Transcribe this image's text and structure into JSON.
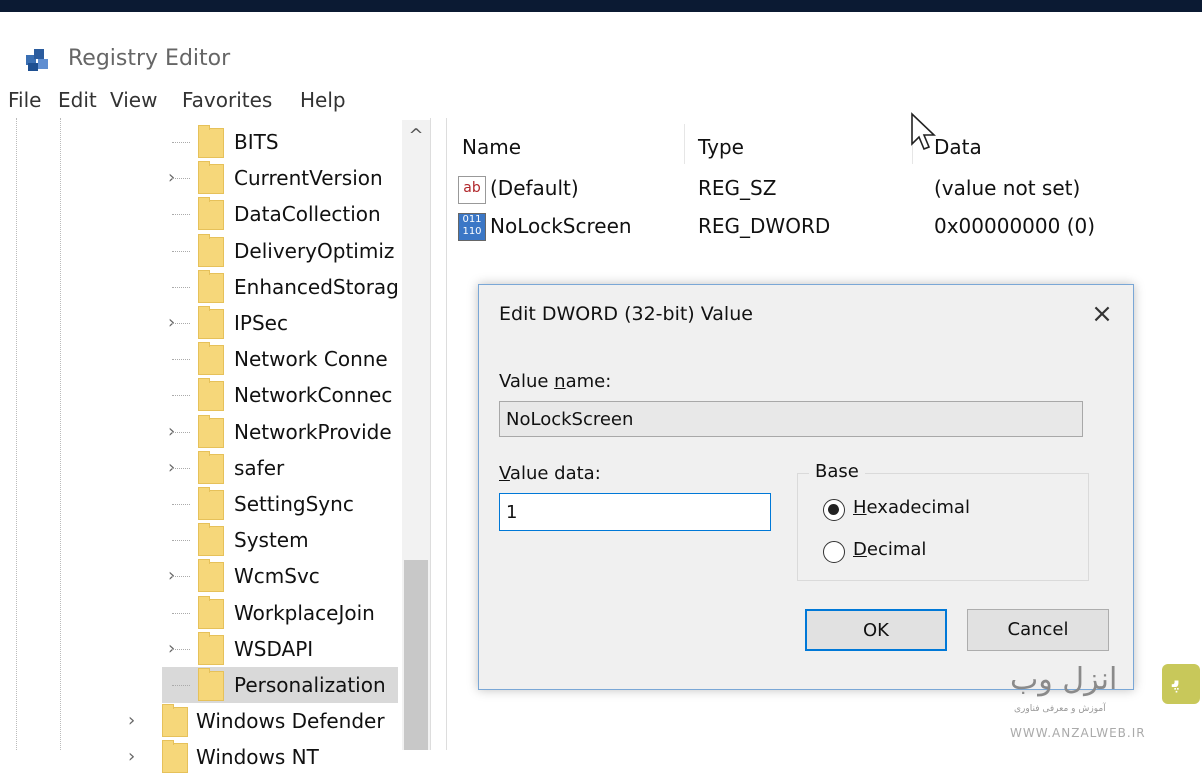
{
  "window": {
    "title": "Registry Editor"
  },
  "menu": [
    "File",
    "Edit",
    "View",
    "Favorites",
    "Help"
  ],
  "tree": {
    "items": [
      {
        "label": "BITS",
        "expandable": false
      },
      {
        "label": "CurrentVersion",
        "expandable": true
      },
      {
        "label": "DataCollection",
        "expandable": false
      },
      {
        "label": "DeliveryOptimiz",
        "expandable": false
      },
      {
        "label": "EnhancedStorag",
        "expandable": false
      },
      {
        "label": "IPSec",
        "expandable": true
      },
      {
        "label": "Network Conne",
        "expandable": false
      },
      {
        "label": "NetworkConnec",
        "expandable": false
      },
      {
        "label": "NetworkProvide",
        "expandable": true
      },
      {
        "label": "safer",
        "expandable": true
      },
      {
        "label": "SettingSync",
        "expandable": false
      },
      {
        "label": "System",
        "expandable": false
      },
      {
        "label": "WcmSvc",
        "expandable": true
      },
      {
        "label": "WorkplaceJoin",
        "expandable": false
      },
      {
        "label": "WSDAPI",
        "expandable": true
      },
      {
        "label": "Personalization",
        "expandable": false,
        "selected": true
      }
    ],
    "parent_items": [
      {
        "label": "Windows Defender",
        "expandable": true
      },
      {
        "label": "Windows NT",
        "expandable": true
      }
    ]
  },
  "values_pane": {
    "headers": {
      "name": "Name",
      "type": "Type",
      "data": "Data"
    },
    "rows": [
      {
        "icon": "string-value-icon",
        "icon_text": "ab",
        "name": "(Default)",
        "type": "REG_SZ",
        "data": "(value not set)"
      },
      {
        "icon": "dword-value-icon",
        "icon_text": "011 110",
        "name": "NoLockScreen",
        "type": "REG_DWORD",
        "data": "0x00000000 (0)"
      }
    ]
  },
  "dialog": {
    "title": "Edit DWORD (32-bit) Value",
    "close": "×",
    "value_name_label": {
      "pre": "Value ",
      "accel": "n",
      "post": "ame:"
    },
    "value_name": "NoLockScreen",
    "value_data_label": {
      "pre": "",
      "accel": "V",
      "post": "alue data:"
    },
    "value_data": "1",
    "base": {
      "title": "Base",
      "options": [
        {
          "accel": "H",
          "rest": "exadecimal",
          "selected": true
        },
        {
          "accel": "D",
          "rest": "ecimal",
          "selected": false
        }
      ]
    },
    "ok_label": "OK",
    "cancel_label": "Cancel"
  },
  "watermark": {
    "text": "انزل وب",
    "sub": "آموزش و معرفی فناوری",
    "url": "WWW.ANZALWEB.IR",
    "logo": "ﭘ",
    "color": "#c8c85a"
  },
  "scroll_up": "^"
}
